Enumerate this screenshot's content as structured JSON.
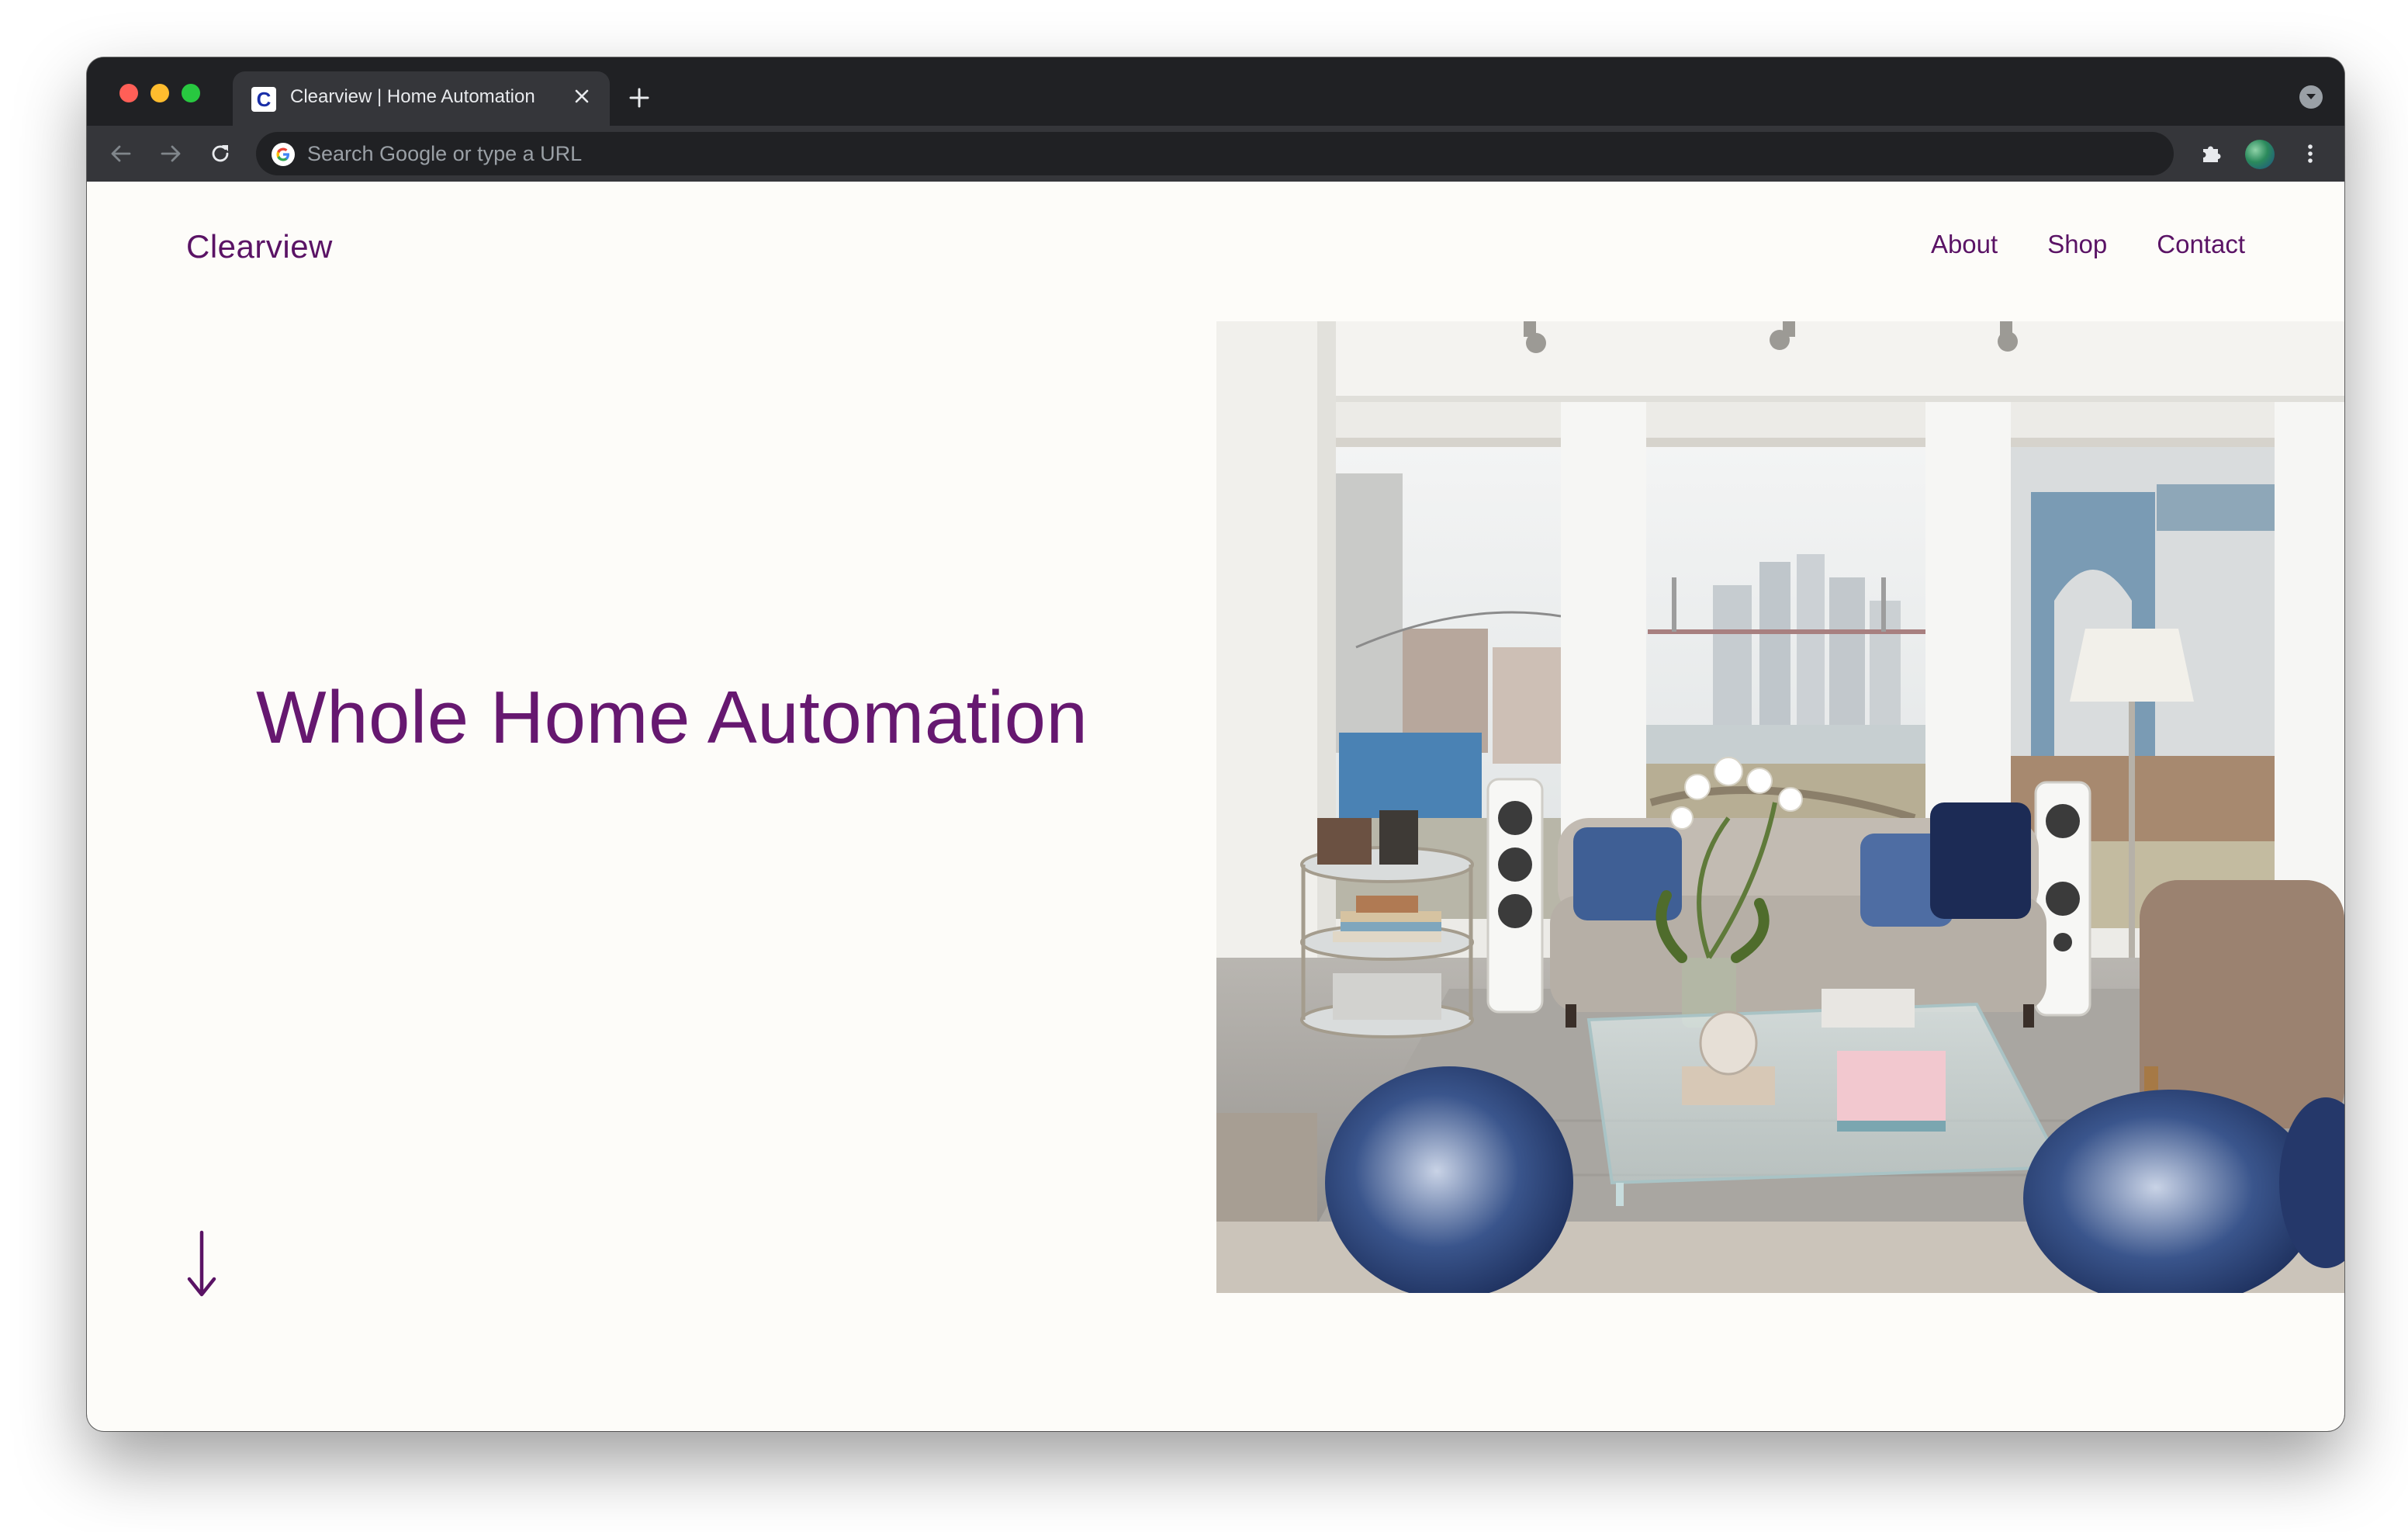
{
  "browser": {
    "tab": {
      "favicon_letter": "C",
      "title": "Clearview | Home Automation"
    },
    "omnibox": {
      "placeholder": "Search Google or type a URL",
      "value": ""
    }
  },
  "site": {
    "brand": "Clearview",
    "nav": [
      {
        "label": "About"
      },
      {
        "label": "Shop"
      },
      {
        "label": "Contact"
      }
    ],
    "hero": {
      "title": "Whole Home Automation",
      "image_subject": "living-room-photo"
    },
    "scroll_indicator": "arrow-down-icon"
  },
  "colors": {
    "brand_purple": "#5a1365",
    "hero_purple": "#661870",
    "page_background": "#fdfcf9",
    "chrome_dark": "#202124",
    "chrome_toolbar": "#35363a"
  }
}
